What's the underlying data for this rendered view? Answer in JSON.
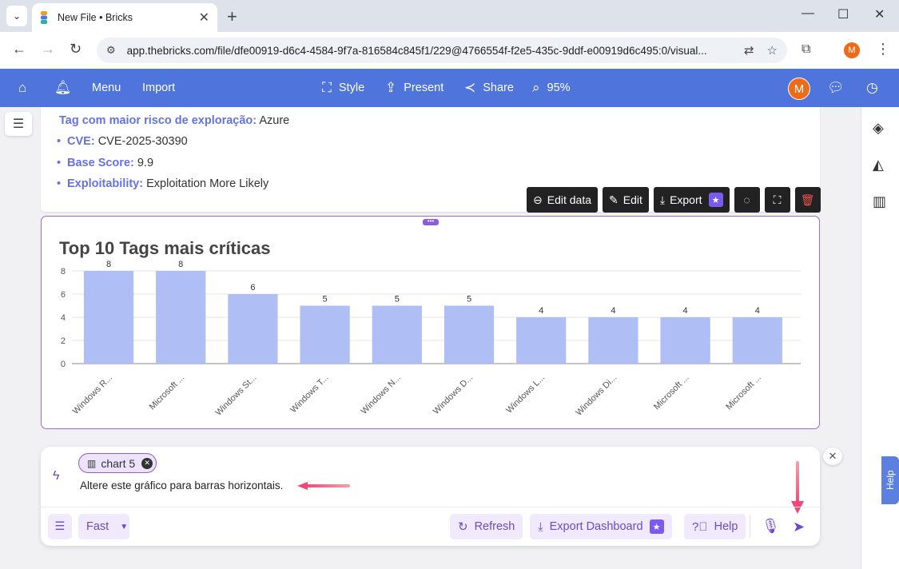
{
  "browser": {
    "tab_title": "New File • Bricks",
    "url": "app.thebricks.com/file/dfe00919-d6c4-4584-9f7a-816584c845f1/229@4766554f-f2e5-435c-9ddf-e00919d6c495:0/visual...",
    "profile_initial": "M"
  },
  "toolbar": {
    "menu_label": "Menu",
    "import_label": "Import",
    "style_label": "Style",
    "present_label": "Present",
    "share_label": "Share",
    "zoom_label": "95%",
    "user_initial": "M",
    "accent": "#4f74dc"
  },
  "text_card": {
    "heading_key": "Tag com maior risco de exploração:",
    "heading_value": "Azure",
    "items": [
      {
        "key": "CVE:",
        "value": "CVE-2025-30390"
      },
      {
        "key": "Base Score:",
        "value": "9.9"
      },
      {
        "key": "Exploitability:",
        "value": "Exploitation More Likely"
      }
    ]
  },
  "chart_toolbar": {
    "edit_data_label": "Edit data",
    "edit_label": "Edit",
    "export_label": "Export"
  },
  "chart_data": {
    "type": "bar",
    "title": "Top 10 Tags mais críticas",
    "categories": [
      "Windows R...",
      "Microsoft ...",
      "Windows St...",
      "Windows T...",
      "Windows N...",
      "Windows D...",
      "Windows L...",
      "Windows Di...",
      "Microsoft ...",
      "Microsoft ..."
    ],
    "values": [
      8,
      8,
      6,
      5,
      5,
      5,
      4,
      4,
      4,
      4
    ],
    "yticks": [
      0,
      2,
      4,
      6,
      8
    ],
    "ylim": [
      0,
      8
    ],
    "grid": true,
    "bar_color": "#afbff5"
  },
  "prompt": {
    "chip_label": "chart 5",
    "text": "Altere este gráfico para barras horizontais.",
    "mode_label": "Fast",
    "refresh_label": "Refresh",
    "export_dashboard_label": "Export Dashboard",
    "help_label": "Help"
  },
  "help_tab_label": "Help"
}
